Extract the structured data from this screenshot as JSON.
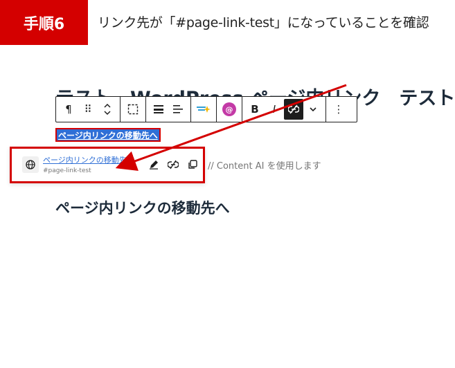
{
  "step": {
    "badge": "手順6",
    "instruction": "リンク先が「#page-link-test」になっていることを確認"
  },
  "editor": {
    "heading": "テスト　WordPress ページ内リンク　テスト",
    "selected_link_text": "ページ内リンクの移動先へ",
    "placeholder": "// Content AI を使用します",
    "subheading": "ページ内リンクの移動先へ"
  },
  "toolbar": {
    "paragraph_icon": "¶",
    "drag_icon": "⠿",
    "move_icon": "⌃",
    "select_icon": "⛶",
    "align_icon": "☰",
    "text_align_icon": "≡",
    "bold_label": "B",
    "italic_label": "I",
    "more_icon": "⋮"
  },
  "link_popover": {
    "title": "ページ内リンクの移動先へ",
    "url": "#page-link-test"
  },
  "colors": {
    "accent_red": "#d40000",
    "link_blue": "#2f6fd6",
    "heading": "#1d2b3a"
  }
}
